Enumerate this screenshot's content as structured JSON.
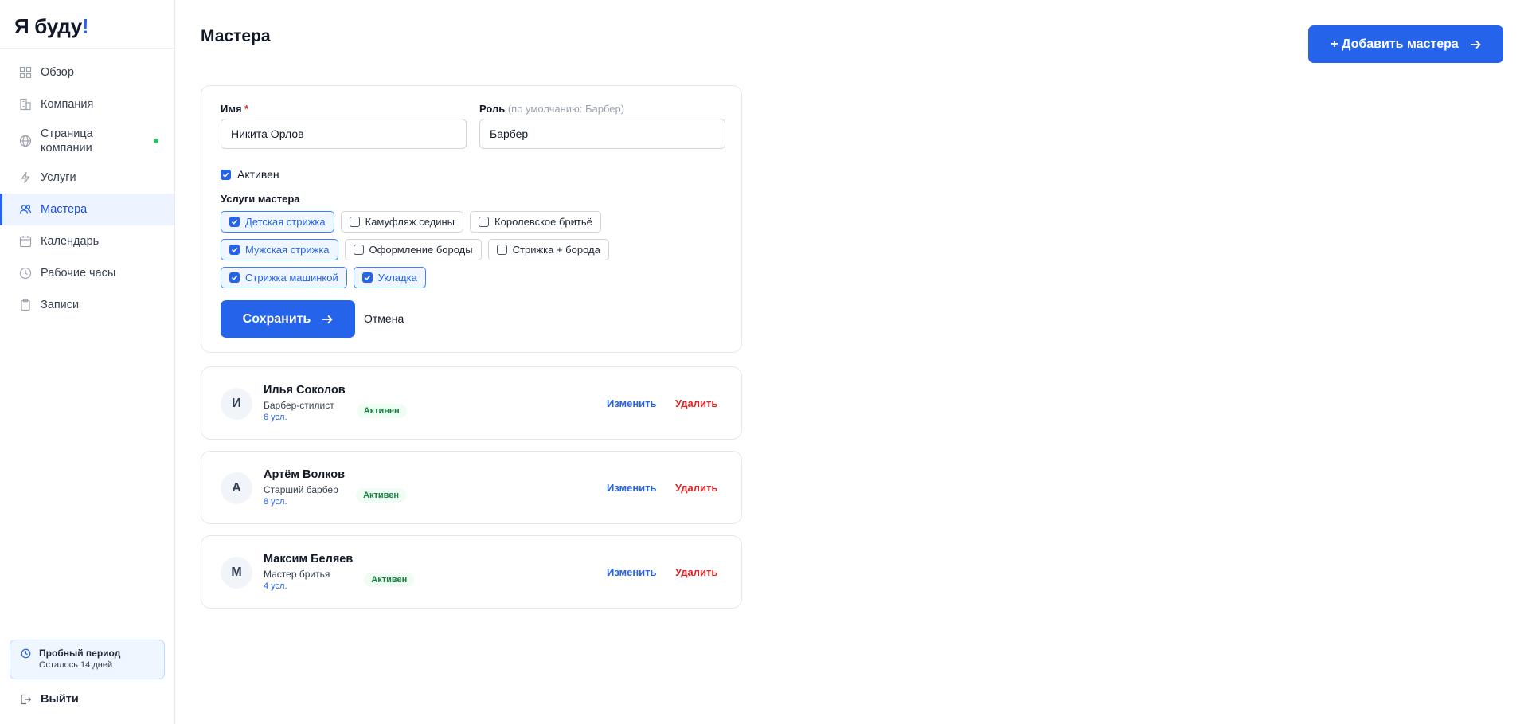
{
  "brand": {
    "name": "Я буду",
    "accent": "!"
  },
  "sidebar": {
    "items": [
      {
        "label": "Обзор",
        "icon": "grid-icon"
      },
      {
        "label": "Компания",
        "icon": "building-icon"
      },
      {
        "label": "Страница компании",
        "icon": "globe-icon",
        "status_dot": "#22c55e"
      },
      {
        "label": "Услуги",
        "icon": "lightning-icon"
      },
      {
        "label": "Мастера",
        "icon": "users-icon",
        "active": true
      },
      {
        "label": "Календарь",
        "icon": "calendar-icon"
      },
      {
        "label": "Рабочие часы",
        "icon": "clock-icon"
      },
      {
        "label": "Записи",
        "icon": "clipboard-icon"
      }
    ],
    "trial": {
      "title": "Пробный период",
      "subtitle": "Осталось 14 дней"
    },
    "logout": "Выйти"
  },
  "header": {
    "title": "Мастера",
    "add_button": "+ Добавить мастера"
  },
  "form": {
    "name_label": "Имя",
    "required_mark": "*",
    "name_value": "Никита Орлов",
    "role_label": "Роль",
    "role_hint": "(по умолчанию: Барбер)",
    "role_value": "Барбер",
    "active_label": "Активен",
    "active_checked": true,
    "services_title": "Услуги мастера",
    "services": [
      [
        {
          "label": "Детская стрижка",
          "checked": true
        },
        {
          "label": "Камуфляж седины",
          "checked": false
        },
        {
          "label": "Королевское бритьё",
          "checked": false
        }
      ],
      [
        {
          "label": "Мужская стрижка",
          "checked": true
        },
        {
          "label": "Оформление бороды",
          "checked": false
        },
        {
          "label": "Стрижка + борода",
          "checked": false
        }
      ],
      [
        {
          "label": "Стрижка машинкой",
          "checked": true
        },
        {
          "label": "Укладка",
          "checked": true
        }
      ]
    ],
    "save_button": "Сохранить",
    "cancel_button": "Отмена"
  },
  "masters": [
    {
      "initial": "И",
      "name": "Илья Соколов",
      "role": "Барбер-стилист",
      "count": "6 усл.",
      "status": "Активен",
      "edit": "Изменить",
      "delete": "Удалить"
    },
    {
      "initial": "А",
      "name": "Артём Волков",
      "role": "Старший барбер",
      "count": "8 усл.",
      "status": "Активен",
      "edit": "Изменить",
      "delete": "Удалить"
    },
    {
      "initial": "М",
      "name": "Максим Беляев",
      "role": "Мастер бритья",
      "count": "4 усл.",
      "status": "Активен",
      "edit": "Изменить",
      "delete": "Удалить"
    }
  ],
  "colors": {
    "accent": "#2563eb",
    "danger": "#dc2626",
    "success": "#15803d"
  }
}
